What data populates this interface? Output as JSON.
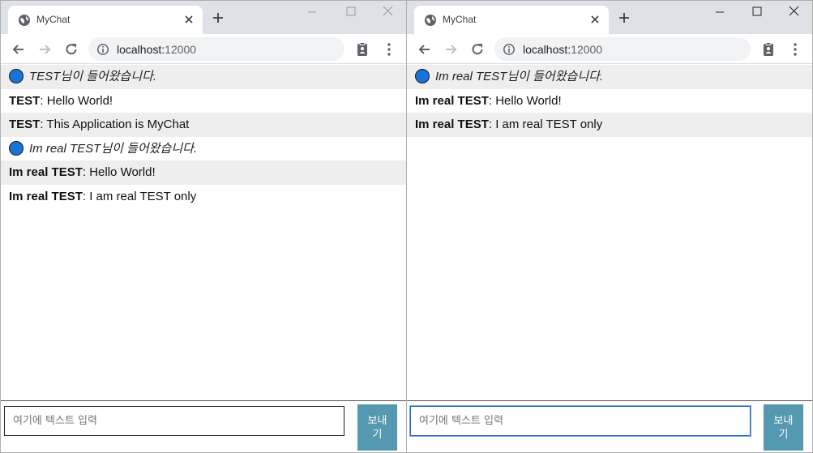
{
  "left_window": {
    "tab_title": "MyChat",
    "url_host": "localhost:",
    "url_port": "12000",
    "messages": [
      {
        "type": "system",
        "text": "TEST님이 들어왔습니다."
      },
      {
        "type": "chat",
        "nick": "TEST",
        "sep": ": ",
        "text": "Hello World!"
      },
      {
        "type": "chat",
        "nick": "TEST",
        "sep": ": ",
        "text": "This Application is MyChat"
      },
      {
        "type": "system",
        "text": "Im real TEST님이 들어왔습니다."
      },
      {
        "type": "chat",
        "nick": "Im real TEST",
        "sep": ": ",
        "text": "Hello World!"
      },
      {
        "type": "chat",
        "nick": "Im real TEST",
        "sep": ": ",
        "text": "I am real TEST only"
      }
    ],
    "input_placeholder": "여기에 텍스트 입력",
    "send_label": "보내기"
  },
  "right_window": {
    "tab_title": "MyChat",
    "url_host": "localhost:",
    "url_port": "12000",
    "messages": [
      {
        "type": "system",
        "text": "Im real TEST님이 들어왔습니다."
      },
      {
        "type": "chat",
        "nick": "Im real TEST",
        "sep": ": ",
        "text": "Hello World!"
      },
      {
        "type": "chat",
        "nick": "Im real TEST",
        "sep": ": ",
        "text": "I am real TEST only"
      }
    ],
    "input_placeholder": "여기에 텍스트 입력",
    "send_label": "보내기"
  },
  "colors": {
    "system_dot": "#1a73d8",
    "send_button": "#5499b0",
    "alt_row": "#eeeeee",
    "tabstrip": "#dee1e6"
  },
  "icons": [
    "globe-icon",
    "close-icon",
    "plus-icon",
    "minimize-icon",
    "maximize-icon",
    "back-icon",
    "forward-icon",
    "reload-icon",
    "info-icon",
    "clipboard-icon",
    "kebab-menu-icon",
    "status-dot-icon"
  ]
}
